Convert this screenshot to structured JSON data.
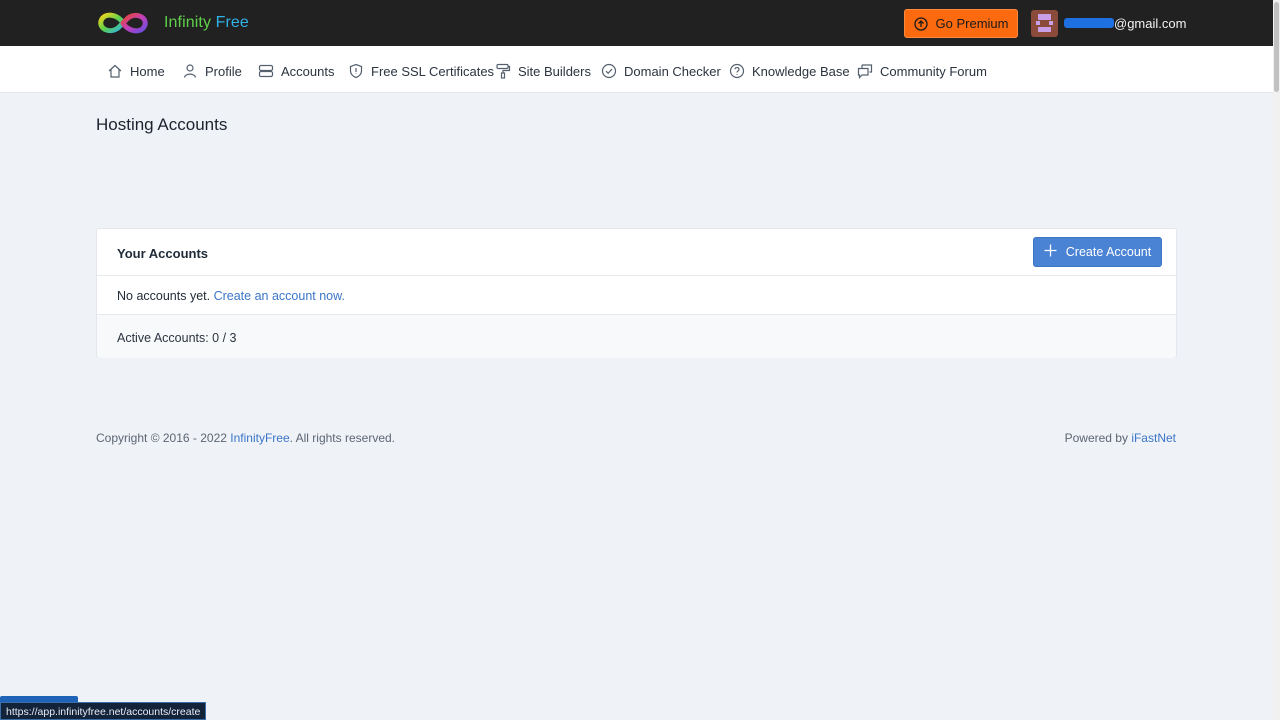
{
  "header": {
    "brand_word1": "Infinity",
    "brand_word2": "Free",
    "premium_label": "Go Premium",
    "user_email": "@gmail.com"
  },
  "nav": {
    "items": [
      {
        "label": "Home",
        "icon": "home-icon"
      },
      {
        "label": "Profile",
        "icon": "user-icon"
      },
      {
        "label": "Accounts",
        "icon": "server-icon"
      },
      {
        "label": "Free SSL Certificates",
        "icon": "shield-icon"
      },
      {
        "label": "Site Builders",
        "icon": "paint-roller-icon"
      },
      {
        "label": "Domain Checker",
        "icon": "check-circle-icon"
      },
      {
        "label": "Knowledge Base",
        "icon": "question-circle-icon"
      },
      {
        "label": "Community Forum",
        "icon": "chat-icon"
      }
    ]
  },
  "main": {
    "page_title": "Hosting Accounts",
    "card": {
      "title": "Your Accounts",
      "create_button": "Create Account",
      "empty_text": "No accounts yet.",
      "empty_link": "Create an account now.",
      "active_accounts": "Active Accounts: 0 / 3"
    }
  },
  "footer": {
    "copyright_prefix": "Copyright © 2016 - 2022",
    "copyright_link": "InfinityFree",
    "copyright_suffix": ". All rights reserved.",
    "powered_prefix": "Powered by",
    "powered_link": "iFastNet"
  },
  "statusbar": {
    "url": "https://app.infinityfree.net/accounts/create"
  },
  "colors": {
    "topbar": "#212121",
    "premium": "#fb6a0e",
    "primary": "#4a82d4",
    "link": "#3b76c8",
    "background": "#eff2f7"
  }
}
